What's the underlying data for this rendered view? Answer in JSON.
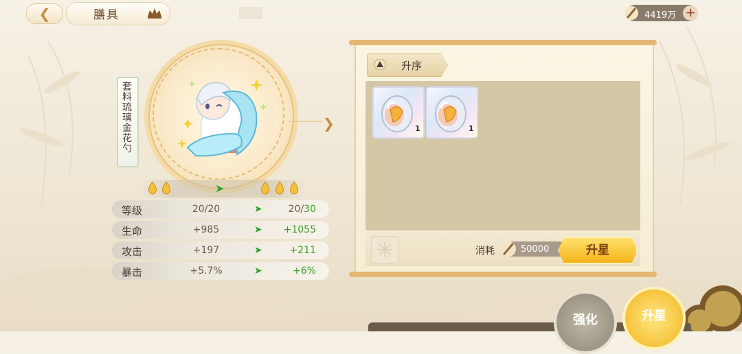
{
  "header": {
    "title": "膳具",
    "currency_amount": "4419万"
  },
  "item": {
    "name": "套料琉璃金花勺"
  },
  "stars": {
    "current": 2,
    "next": 3
  },
  "stats": [
    {
      "label": "等级",
      "current": "20/20",
      "next_prefix": "20/",
      "next_value": "30"
    },
    {
      "label": "生命",
      "current": "+985",
      "next_prefix": "",
      "next_value": "+1055"
    },
    {
      "label": "攻击",
      "current": "+197",
      "next_prefix": "",
      "next_value": "+211"
    },
    {
      "label": "暴击",
      "current": "+5.7%",
      "next_prefix": "",
      "next_value": "+6%"
    }
  ],
  "panel": {
    "sort_label": "升序",
    "items": [
      {
        "count": "1"
      },
      {
        "count": "1"
      }
    ],
    "cost_label": "消耗",
    "cost_amount": "50000",
    "upstar_label": "升星"
  },
  "bottom_buttons": {
    "strengthen": "强化",
    "upstar": "升星"
  },
  "colors": {
    "accent_gold": "#f4b41a",
    "increase_green": "#3b9a2a"
  }
}
